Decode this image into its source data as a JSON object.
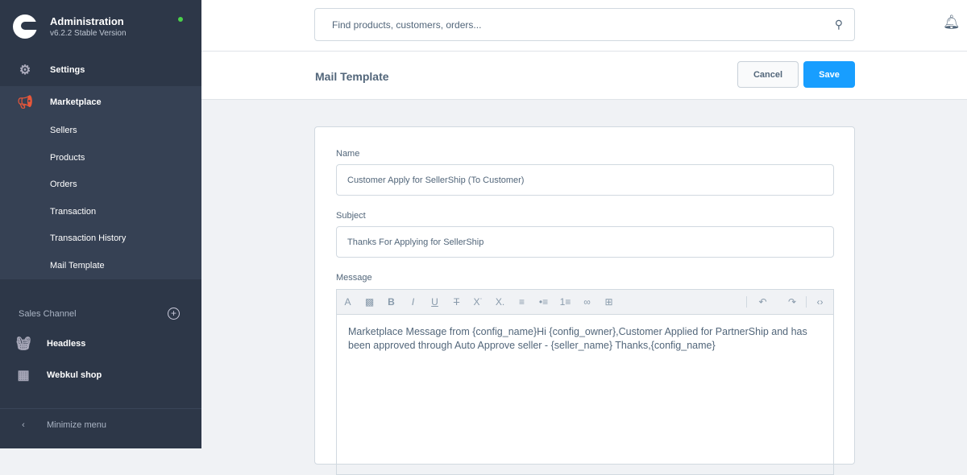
{
  "sidebar": {
    "brand": "Administration",
    "version": "v6.2.2 Stable Version",
    "settings": "Settings",
    "marketplace": "Marketplace",
    "sub": [
      "Sellers",
      "Products",
      "Orders",
      "Transaction",
      "Transaction History",
      "Mail Template"
    ],
    "sales_channel": "Sales Channel",
    "channels": [
      "Headless",
      "Webkul shop"
    ],
    "minimize": "Minimize menu"
  },
  "search": {
    "placeholder": "Find products, customers, orders..."
  },
  "header": {
    "title": "Mail Template",
    "cancel": "Cancel",
    "save": "Save"
  },
  "form": {
    "name_label": "Name",
    "name_value": "Customer Apply for SellerShip (To Customer)",
    "subject_label": "Subject",
    "subject_value": "Thanks For Applying for SellerShip",
    "message_label": "Message",
    "message_value": "Marketplace Message from {config_name}Hi {config_owner},Customer Applied for PartnerShip and has been approved through Auto Approve seller -  {seller_name} Thanks,{config_name}"
  }
}
